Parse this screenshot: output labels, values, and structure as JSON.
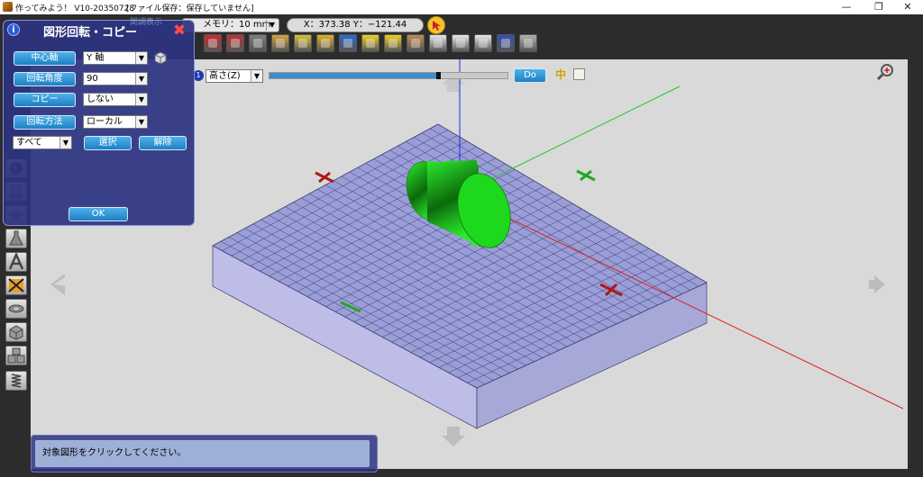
{
  "window": {
    "title": "作ってみよう！ V10-20350728",
    "file_status": "[ファイル保存：保存していません]",
    "controls": {
      "minimize": "—",
      "maximize": "❐",
      "close": "✕"
    }
  },
  "toolbar": {
    "unit_value": "メモリ：10 mm",
    "coord_readout": "X：373.38  Y：−121.44",
    "buttons": [
      {
        "name": "fit-view-icon",
        "color": "#d02828"
      },
      {
        "name": "scissors-icon",
        "color": "#c03030"
      },
      {
        "name": "box-icon",
        "color": "#7d7d7d"
      },
      {
        "name": "palette-icon",
        "color": "#d2a23c"
      },
      {
        "name": "ruler-icon",
        "color": "#d8c030"
      },
      {
        "name": "gear-icon",
        "color": "#e0b020"
      },
      {
        "name": "door-icon",
        "color": "#2c6ad0"
      },
      {
        "name": "arrow-left-icon",
        "color": "#f0d020"
      },
      {
        "name": "arrow-right-icon",
        "color": "#f0d020"
      },
      {
        "name": "brush-icon",
        "color": "#c08850"
      },
      {
        "name": "wave-icon",
        "color": "#e8e8e8"
      },
      {
        "name": "camera-icon",
        "color": "#e8e8e8"
      },
      {
        "name": "export-icon",
        "color": "#e8e8e8"
      },
      {
        "name": "help-icon",
        "color": "#3050b8"
      },
      {
        "name": "calculator-icon",
        "color": "#b0b0b0"
      }
    ]
  },
  "height_control": {
    "index": "1",
    "select_value": "高さ(Z)",
    "slider_fraction": 0.71,
    "do_label": "Do",
    "center_label": "中"
  },
  "dialog": {
    "title": "図形回転・コピー",
    "info": "i",
    "close_label": "✖",
    "center_axis_label": "中心軸",
    "center_axis_value": "Y 軸",
    "angle_label": "回転角度",
    "angle_value": "90",
    "copy_label": "コピー",
    "copy_value": "しない",
    "method_label": "回転方法",
    "method_value": "ローカル",
    "scope_value": "すべて",
    "select_label": "選択",
    "release_label": "解除",
    "ok_label": "OK",
    "behind_label": "関調表示"
  },
  "status": {
    "message": "対象図形をクリックしてください。"
  },
  "colors": {
    "grid_fill": "#9a9ed8",
    "grid_line": "#3c3c6a",
    "cylinder": "#1ed81e",
    "axis_x": "#e02020",
    "axis_y": "#28c828",
    "axis_z": "#1a2ae8",
    "dialog_bg": "#2d3480",
    "button_blue": "#2a8fd4"
  }
}
